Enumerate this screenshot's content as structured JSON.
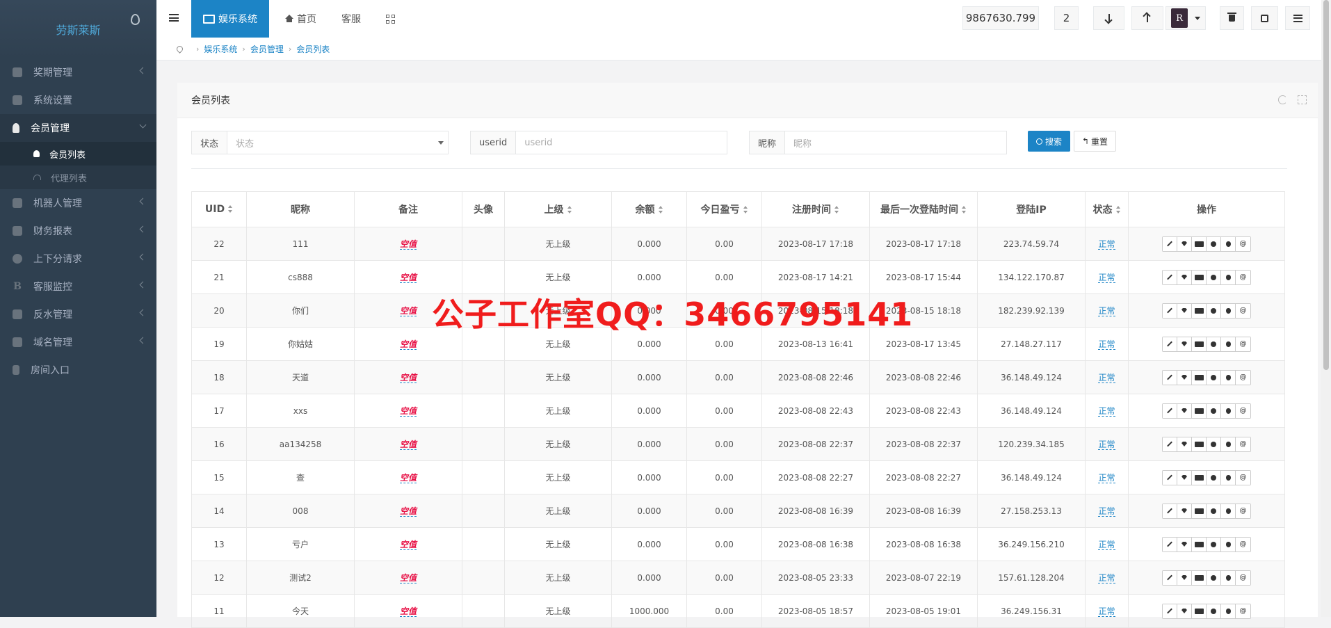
{
  "brand": "劳斯莱斯",
  "sidebar": {
    "items": [
      {
        "label": "奖期管理",
        "icon": "dashboard-icon"
      },
      {
        "label": "系统设置",
        "icon": "wrench-icon"
      },
      {
        "label": "会员管理",
        "icon": "user-icon"
      },
      {
        "label": "机器人管理",
        "icon": "puzzle-icon"
      },
      {
        "label": "财务报表",
        "icon": "list-icon"
      },
      {
        "label": "上下分请求",
        "icon": "clock-icon"
      },
      {
        "label": "客服监控",
        "icon": "b-icon"
      },
      {
        "label": "反水管理",
        "icon": "gavel-icon"
      },
      {
        "label": "域名管理",
        "icon": "heart-icon"
      },
      {
        "label": "房间入口",
        "icon": "lock-icon"
      }
    ],
    "sub": [
      {
        "label": "会员列表"
      },
      {
        "label": "代理列表"
      }
    ]
  },
  "topbar": {
    "active_tab": "娱乐系统",
    "home": "首页",
    "service": "客服",
    "balance": "9867630.799",
    "count": "2",
    "logo_text": "R"
  },
  "breadcrumb": [
    "娱乐系统",
    "会员管理",
    "会员列表"
  ],
  "panel": {
    "title": "会员列表",
    "filters": [
      {
        "label": "状态",
        "placeholder": "状态"
      },
      {
        "label": "userid",
        "placeholder": "userid"
      },
      {
        "label": "昵称",
        "placeholder": "昵称"
      }
    ],
    "search_label": "搜索",
    "reset_label": "重置"
  },
  "table": {
    "headers": [
      "UID",
      "昵称",
      "备注",
      "头像",
      "上级",
      "余额",
      "今日盈亏",
      "注册时间",
      "最后一次登陆时间",
      "登陆IP",
      "状态",
      "操作"
    ],
    "rows": [
      [
        "22",
        "111",
        "空值",
        "",
        "无上级",
        "0.000",
        "0.00",
        "2023-08-17 17:18",
        "2023-08-17 17:18",
        "223.74.59.74",
        "正常"
      ],
      [
        "21",
        "cs888",
        "空值",
        "",
        "无上级",
        "0.000",
        "0.00",
        "2023-08-17 14:21",
        "2023-08-17 15:44",
        "134.122.170.87",
        "正常"
      ],
      [
        "20",
        "你们",
        "空值",
        "",
        "无上级",
        "0.000",
        "0.00",
        "2023-08-15 18:18",
        "2023-08-15 18:18",
        "182.239.92.139",
        "正常"
      ],
      [
        "19",
        "你姑姑",
        "空值",
        "",
        "无上级",
        "0.000",
        "0.00",
        "2023-08-13 16:41",
        "2023-08-17 13:45",
        "27.148.27.117",
        "正常"
      ],
      [
        "18",
        "天道",
        "空值",
        "",
        "无上级",
        "0.000",
        "0.00",
        "2023-08-08 22:46",
        "2023-08-08 22:46",
        "36.148.49.124",
        "正常"
      ],
      [
        "17",
        "xxs",
        "空值",
        "",
        "无上级",
        "0.000",
        "0.00",
        "2023-08-08 22:43",
        "2023-08-08 22:43",
        "36.148.49.124",
        "正常"
      ],
      [
        "16",
        "aa134258",
        "空值",
        "",
        "无上级",
        "0.000",
        "0.00",
        "2023-08-08 22:37",
        "2023-08-08 22:37",
        "120.239.34.185",
        "正常"
      ],
      [
        "15",
        "查",
        "空值",
        "",
        "无上级",
        "0.000",
        "0.00",
        "2023-08-08 22:27",
        "2023-08-08 22:27",
        "36.148.49.124",
        "正常"
      ],
      [
        "14",
        "008",
        "空值",
        "",
        "无上级",
        "0.000",
        "0.00",
        "2023-08-08 16:39",
        "2023-08-08 16:39",
        "27.158.253.13",
        "正常"
      ],
      [
        "13",
        "亏户",
        "空值",
        "",
        "无上级",
        "0.000",
        "0.00",
        "2023-08-08 16:38",
        "2023-08-08 16:38",
        "36.249.156.210",
        "正常"
      ],
      [
        "12",
        "测试2",
        "空值",
        "",
        "无上级",
        "0.000",
        "0.00",
        "2023-08-05 23:33",
        "2023-08-07 22:19",
        "157.61.128.204",
        "正常"
      ],
      [
        "11",
        "今天",
        "空值",
        "",
        "无上级",
        "1000.000",
        "0.00",
        "2023-08-05 18:57",
        "2023-08-05 19:01",
        "36.249.156.31",
        "正常"
      ]
    ],
    "op_icons": [
      "edit-icon",
      "diamond-icon",
      "visa-icon",
      "chrome-icon",
      "apple-icon",
      "at-icon"
    ]
  },
  "watermark": "公子工作室QQ：3466795141",
  "colors": {
    "sidebar": "#2f4050",
    "primary": "#1c84c6",
    "remark": "#e81448",
    "watermark": "#f01c1c"
  }
}
